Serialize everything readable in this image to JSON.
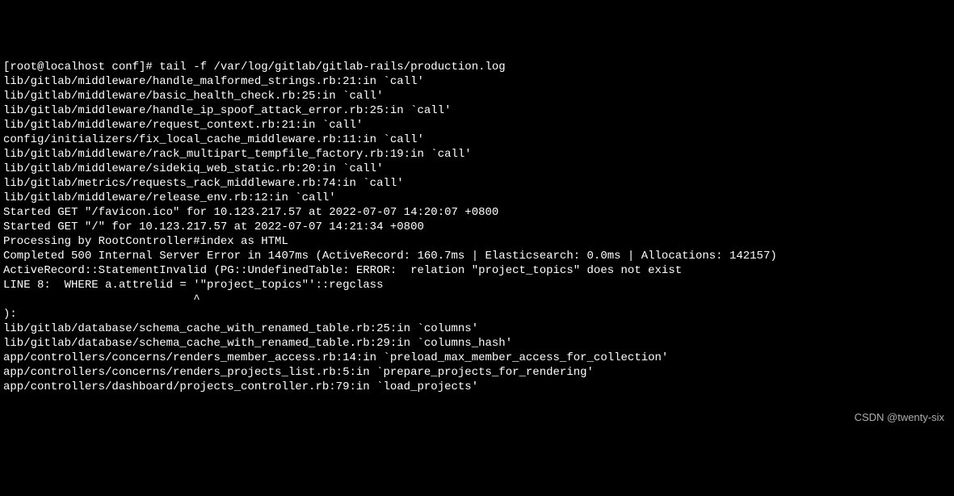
{
  "terminal": {
    "lines": [
      "[root@localhost conf]# tail -f /var/log/gitlab/gitlab-rails/production.log",
      "lib/gitlab/middleware/handle_malformed_strings.rb:21:in `call'",
      "lib/gitlab/middleware/basic_health_check.rb:25:in `call'",
      "lib/gitlab/middleware/handle_ip_spoof_attack_error.rb:25:in `call'",
      "lib/gitlab/middleware/request_context.rb:21:in `call'",
      "config/initializers/fix_local_cache_middleware.rb:11:in `call'",
      "lib/gitlab/middleware/rack_multipart_tempfile_factory.rb:19:in `call'",
      "lib/gitlab/middleware/sidekiq_web_static.rb:20:in `call'",
      "lib/gitlab/metrics/requests_rack_middleware.rb:74:in `call'",
      "lib/gitlab/middleware/release_env.rb:12:in `call'",
      "Started GET \"/favicon.ico\" for 10.123.217.57 at 2022-07-07 14:20:07 +0800",
      "",
      "",
      "Started GET \"/\" for 10.123.217.57 at 2022-07-07 14:21:34 +0800",
      "Processing by RootController#index as HTML",
      "Completed 500 Internal Server Error in 1407ms (ActiveRecord: 160.7ms | Elasticsearch: 0.0ms | Allocations: 142157)",
      "",
      "ActiveRecord::StatementInvalid (PG::UndefinedTable: ERROR:  relation \"project_topics\" does not exist",
      "LINE 8:  WHERE a.attrelid = '\"project_topics\"'::regclass",
      "                            ^",
      "):",
      "",
      "lib/gitlab/database/schema_cache_with_renamed_table.rb:25:in `columns'",
      "lib/gitlab/database/schema_cache_with_renamed_table.rb:29:in `columns_hash'",
      "app/controllers/concerns/renders_member_access.rb:14:in `preload_max_member_access_for_collection'",
      "app/controllers/concerns/renders_projects_list.rb:5:in `prepare_projects_for_rendering'",
      "app/controllers/dashboard/projects_controller.rb:79:in `load_projects'"
    ]
  },
  "watermark": {
    "text": "CSDN @twenty-six"
  }
}
